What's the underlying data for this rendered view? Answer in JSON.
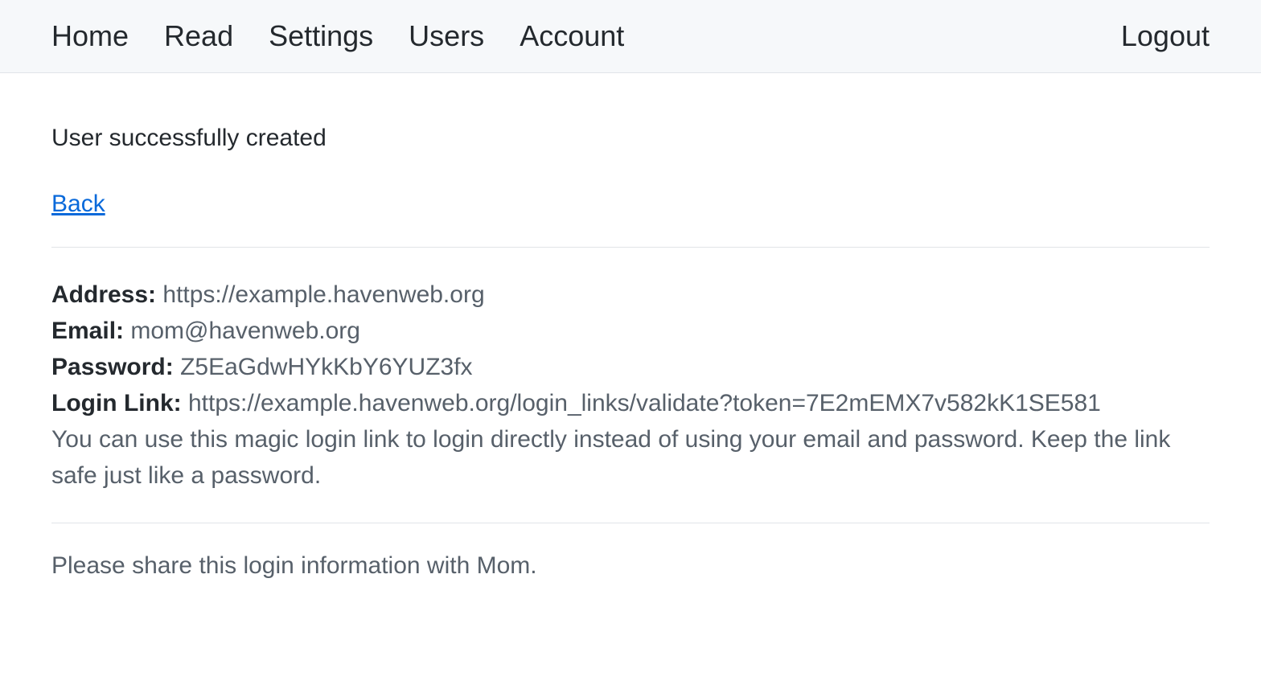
{
  "nav": {
    "home": "Home",
    "read": "Read",
    "settings": "Settings",
    "users": "Users",
    "account": "Account",
    "logout": "Logout"
  },
  "status": {
    "message": "User successfully created"
  },
  "back": {
    "label": "Back"
  },
  "user": {
    "address_label": "Address:",
    "address_value": "https://example.havenweb.org",
    "email_label": "Email:",
    "email_value": "mom@havenweb.org",
    "password_label": "Password:",
    "password_value": "Z5EaGdwHYkKbY6YUZ3fx",
    "login_link_label": "Login Link:",
    "login_link_value": "https://example.havenweb.org/login_links/validate?token=7E2mEMX7v582kK1SE581",
    "login_link_note": "You can use this magic login link to login directly instead of using your email and password. Keep the link safe just like a password."
  },
  "share_note": "Please share this login information with Mom."
}
